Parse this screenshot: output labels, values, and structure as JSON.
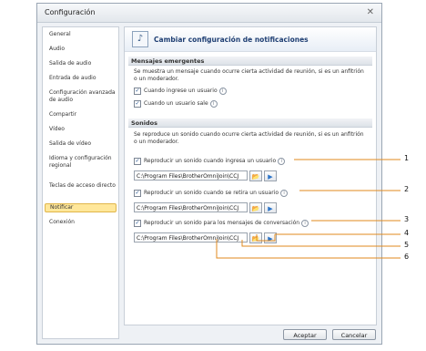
{
  "window": {
    "title": "Configuración"
  },
  "sidebar": {
    "items": [
      {
        "label": "General",
        "selected": false
      },
      {
        "label": "Audio",
        "selected": false
      },
      {
        "label": "Salida de audio",
        "selected": false
      },
      {
        "label": "Entrada de audio",
        "selected": false
      },
      {
        "label": "Configuración avanzada de audio",
        "selected": false
      },
      {
        "label": "Compartir",
        "selected": false
      },
      {
        "label": "Vídeo",
        "selected": false
      },
      {
        "label": "Salida de vídeo",
        "selected": false
      },
      {
        "label": "Idioma y configuración regional",
        "selected": false
      },
      {
        "label": "Teclas de acceso directo",
        "selected": false
      },
      {
        "label": "Notificar",
        "selected": true
      },
      {
        "label": "Conexión",
        "selected": false
      }
    ]
  },
  "header": {
    "title": "Cambiar configuración de notificaciones",
    "icon": "music-note-icon"
  },
  "messages": {
    "heading": "Mensajes emergentes",
    "description": "Se muestra un mensaje cuando ocurre cierta actividad de reunión, si es un anfitrión o un moderador.",
    "options": [
      {
        "label": "Cuando ingrese un usuario",
        "checked": true
      },
      {
        "label": "Cuando un usuario sale",
        "checked": true
      }
    ]
  },
  "sounds": {
    "heading": "Sonidos",
    "description": "Se reproduce un sonido cuando ocurre cierta actividad de reunión, si es un anfitrión o un moderador.",
    "items": [
      {
        "label": "Reproducir un sonido cuando ingresa un usuario",
        "checked": true,
        "path": "C:\\Program Files\\BrotherOmniJoin\\CCJ"
      },
      {
        "label": "Reproducir un sonido cuando se retira un usuario",
        "checked": true,
        "path": "C:\\Program Files\\BrotherOmniJoin\\CCJ"
      },
      {
        "label": "Reproducir un sonido para los mensajes de conversación",
        "checked": true,
        "path": "C:\\Program Files\\BrotherOmniJoin\\CCJ"
      }
    ]
  },
  "buttons": {
    "accept": "Aceptar",
    "cancel": "Cancelar"
  },
  "callouts": [
    "1",
    "2",
    "3",
    "4",
    "5",
    "6"
  ],
  "colors": {
    "callout_line": "#e08a1e",
    "selected_bg": "#ffe79a",
    "header_text": "#1f3f73"
  }
}
